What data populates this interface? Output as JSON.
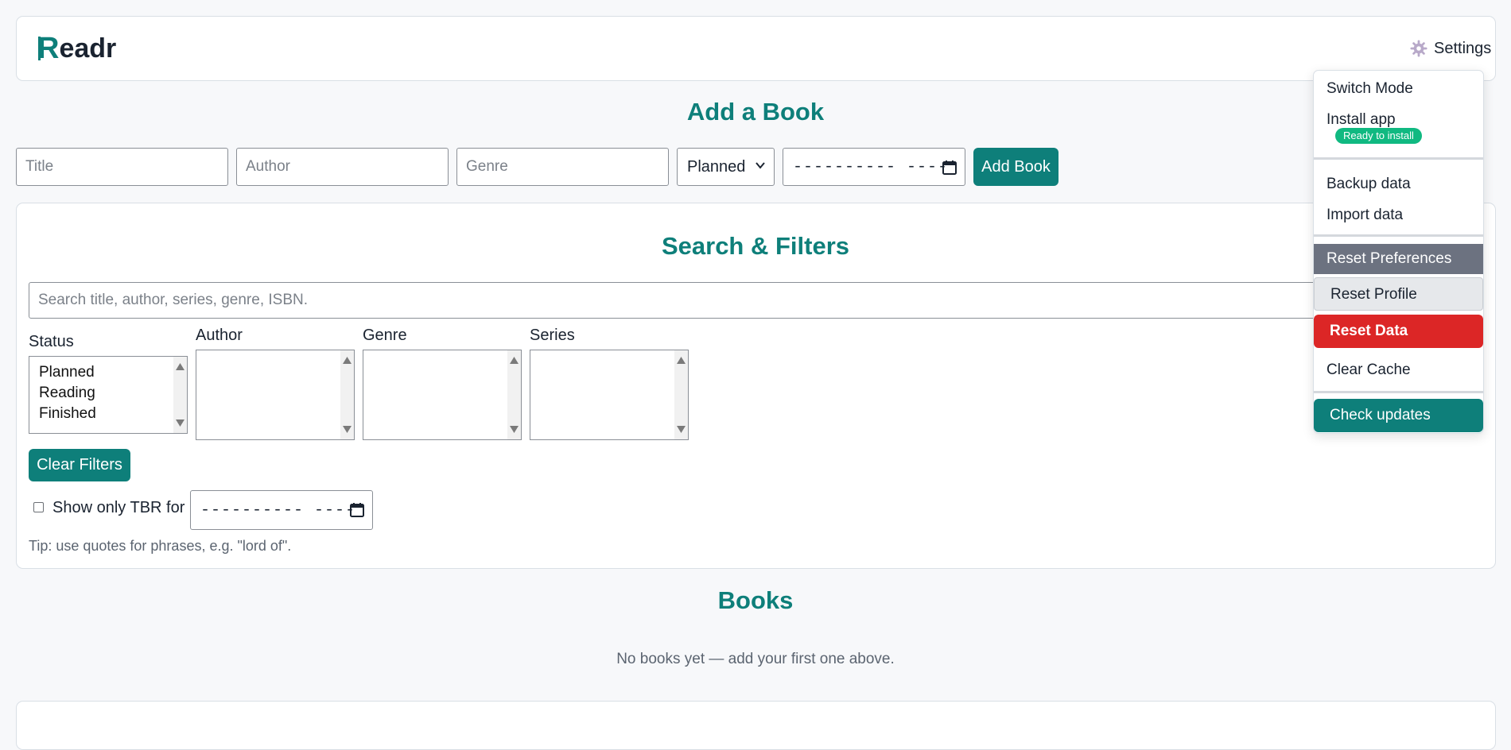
{
  "app": {
    "logo_mark": "R",
    "logo_text": "eadr"
  },
  "header": {
    "settings_label": "Settings",
    "settings_icon": "gear-icon"
  },
  "add_book": {
    "title": "Add a Book",
    "title_placeholder": "Title",
    "author_placeholder": "Author",
    "genre_placeholder": "Genre",
    "status_value": "Planned",
    "date_value": "---------- ----",
    "add_button": "Add Book"
  },
  "filters": {
    "title": "Search & Filters",
    "search_placeholder": "Search title, author, series, genre, ISBN.",
    "status_label": "Status",
    "status_options": [
      "Planned",
      "Reading",
      "Finished"
    ],
    "author_label": "Author",
    "genre_label": "Genre",
    "series_label": "Series",
    "clear_button": "Clear Filters",
    "tbr_label": "Show only TBR for",
    "tbr_date_value": "---------- ----",
    "tip": "Tip: use quotes for phrases, e.g. \"lord of\"."
  },
  "books": {
    "title": "Books",
    "empty_message": "No books yet — add your first one above."
  },
  "settings_menu": {
    "switch_mode": "Switch Mode",
    "install_app": "Install app",
    "install_badge": "Ready to install",
    "backup": "Backup data",
    "import": "Import data",
    "reset_preferences": "Reset Preferences",
    "reset_profile": "Reset Profile",
    "reset_data": "Reset Data",
    "clear_cache": "Clear Cache",
    "check_updates": "Check updates"
  },
  "colors": {
    "accent": "#0e7f7a",
    "danger": "#dc2626",
    "badge": "#10b981",
    "muted_button": "#6c7280"
  }
}
